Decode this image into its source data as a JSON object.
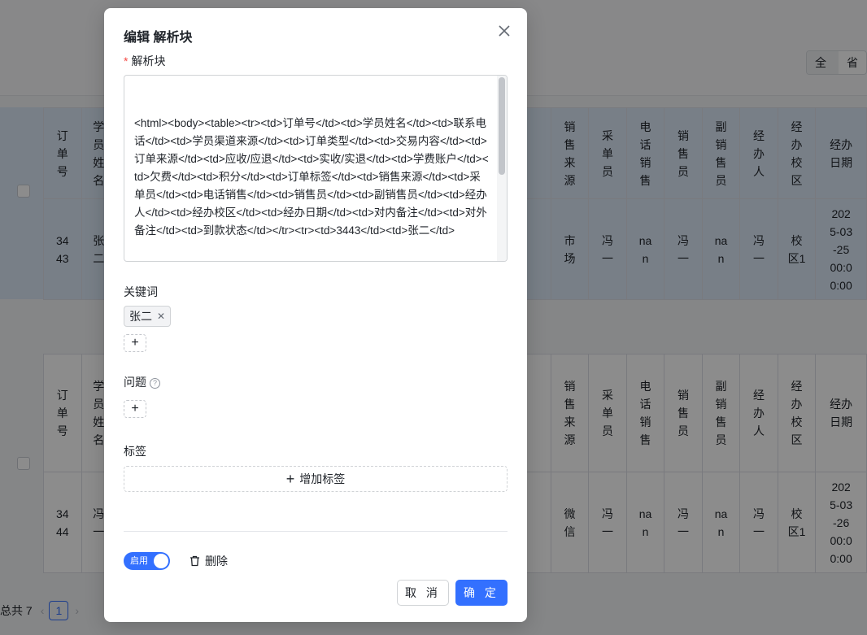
{
  "background": {
    "view_toggle": [
      "全文",
      "省"
    ],
    "tables": [
      {
        "header": [
          "订\n单\n号",
          "学\n员\n姓\n名",
          "销\n售\n来\n源",
          "采\n单\n员",
          "电\n话\n销\n售",
          "销\n售\n员",
          "副\n销\n售\n员",
          "经\n办\n人",
          "经\n办\n校\n区",
          "经办\n日期"
        ],
        "row": [
          "34\n43",
          "张\n二",
          "市\n场",
          "冯\n一",
          "na\nn",
          "冯\n一",
          "na\nn",
          "冯\n一",
          "校\n区1",
          "202\n5-03\n-25\n00:0\n0:00"
        ]
      },
      {
        "header": [
          "订\n单\n号",
          "学\n员\n姓\n名",
          "销\n售\n来\n源",
          "采\n单\n员",
          "电\n话\n销\n售",
          "销\n售\n员",
          "副\n销\n售\n员",
          "经\n办\n人",
          "经\n办\n校\n区",
          "经办\n日期"
        ],
        "row": [
          "34\n44",
          "冯\n一",
          "微\n信",
          "冯\n一",
          "na\nn",
          "冯\n一",
          "na\nn",
          "冯\n一",
          "校\n区1",
          "202\n5-03\n-26\n00:0\n0:00"
        ]
      }
    ],
    "pager": {
      "total": "总共 7",
      "current_page": "1"
    }
  },
  "modal": {
    "title": "编辑 解析块",
    "chunk_label": "解析块",
    "chunk_required_mark": "*",
    "chunk_text": "<html><body><table><tr><td>订单号</td><td>学员姓名</td><td>联系电话</td><td>学员渠道来源</td><td>订单类型</td><td>交易内容</td><td>订单来源</td><td>应收/应退</td><td>实收/实退</td><td>学费账户</td><td>欠费</td><td>积分</td><td>订单标签</td><td>销售来源</td><td>采单员</td><td>电话销售</td><td>销售员</td><td>副销售员</td><td>经办人</td><td>经办校区</td><td>经办日期</td><td>对内备注</td><td>对外备注</td><td>到款状态</td></tr><tr><td>3443</td><td>张二</td>",
    "keywords_label": "关键词",
    "keywords": [
      "张二"
    ],
    "question_label": "问题",
    "tags_label": "标签",
    "add_tag_label": "增加标签",
    "enable_label": "启用",
    "enabled": true,
    "delete_label": "删除",
    "cancel_label": "取 消",
    "ok_label": "确 定"
  }
}
